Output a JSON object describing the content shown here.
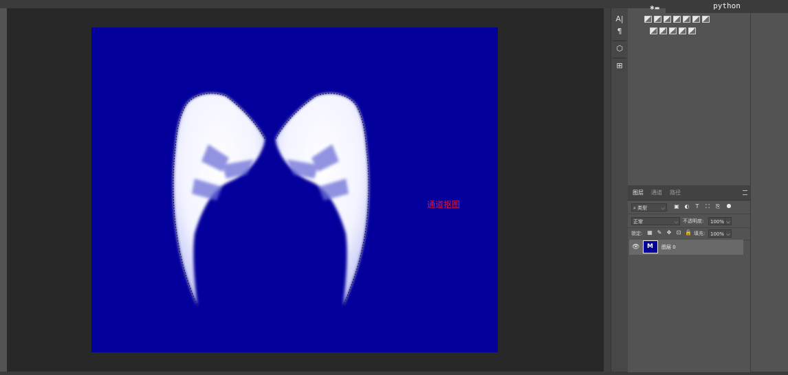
{
  "app": {
    "script_tag": "python"
  },
  "canvas": {
    "annotation": "通道抠图",
    "background_color": "#04009c",
    "annotation_color": "#e0143c"
  },
  "icon_column": {
    "items": [
      "character-icon",
      "paragraph-icon",
      "3d-icon",
      "properties-icon"
    ],
    "glyphs": [
      "A|",
      "¶",
      "⬡",
      "⊞"
    ]
  },
  "adjustments": {
    "row1_icons": [
      "brightness-contrast-icon",
      "levels-icon",
      "curves-icon",
      "exposure-icon",
      "vibrance-icon",
      "hue-sat-icon",
      "color-balance-icon"
    ],
    "row2_icons": [
      "photo-filter-icon",
      "channel-mixer-icon",
      "color-lookup-icon",
      "invert-icon",
      "posterize-icon",
      "threshold-icon"
    ]
  },
  "layers_panel": {
    "tabs": [
      "图层",
      "通道",
      "路径"
    ],
    "active_tab": 0,
    "filter_kind": "类型",
    "blend_mode": "正常",
    "opacity_label": "不透明度:",
    "opacity_value": "100%",
    "lock_label": "锁定:",
    "fill_label": "填充:",
    "fill_value": "100%",
    "layers": [
      {
        "name": "图层 0",
        "visible": true
      }
    ]
  }
}
